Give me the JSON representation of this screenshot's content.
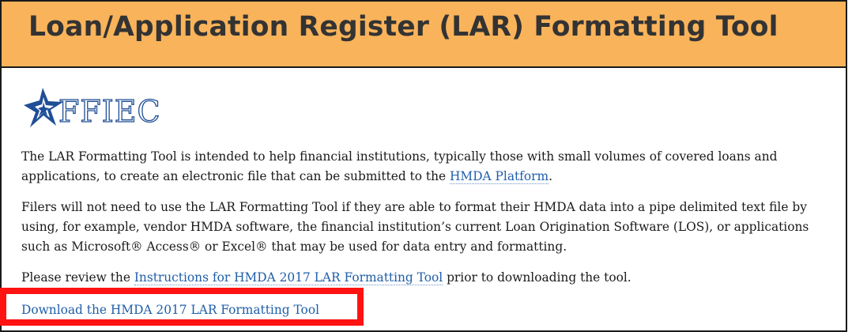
{
  "banner": {
    "title": "Loan/Application Register (LAR) Formatting Tool",
    "background_color": "#f9b35a"
  },
  "logo": {
    "text": "FFIEC",
    "icon": "ffiec-star-icon",
    "color": "#1f4e96"
  },
  "intro": {
    "text_before": "The LAR Formatting Tool is intended to help financial institutions, typically those with small volumes of covered loans and applications, to create an electronic file that can be submitted to the ",
    "link_text": "HMDA Platform",
    "text_after": "."
  },
  "filers": {
    "text": "Filers will not need to use the LAR Formatting Tool if they are able to format their HMDA data into a pipe delimited text file by using, for example, vendor HMDA software, the financial institution’s current Loan Origination Software (LOS), or applications such as Microsoft® Access® or Excel® that may be used for data entry and formatting."
  },
  "review": {
    "text_before": "Please review the ",
    "link_text": "Instructions for HMDA 2017 LAR Formatting Tool",
    "text_after": " prior to downloading the tool."
  },
  "download": {
    "link_text": "Download the HMDA 2017 LAR Formatting Tool",
    "highlight_color": "#ff1212"
  },
  "colors": {
    "link": "#1f5fa8",
    "text": "#1a1a1a"
  }
}
